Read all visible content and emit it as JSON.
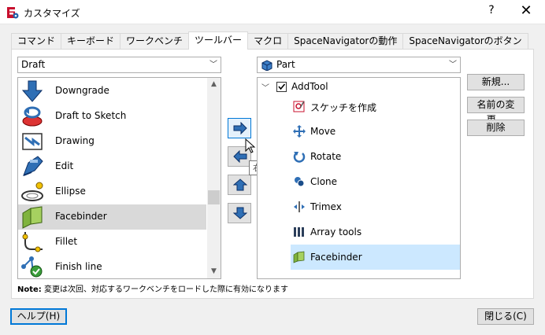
{
  "window": {
    "title": "カスタマイズ",
    "help_glyph": "?",
    "close_glyph": "✕"
  },
  "tabs": [
    "コマンド",
    "キーボード",
    "ワークベンチ",
    "ツールバー",
    "マクロ",
    "SpaceNavigatorの動作",
    "SpaceNavigatorのボタン"
  ],
  "active_tab": "ツールバー",
  "left": {
    "category": "Draft",
    "commands": [
      {
        "label": "Downgrade",
        "icon": "downgrade-icon"
      },
      {
        "label": "Draft to Sketch",
        "icon": "draft-to-sketch-icon"
      },
      {
        "label": "Drawing",
        "icon": "drawing-icon"
      },
      {
        "label": "Edit",
        "icon": "edit-icon"
      },
      {
        "label": "Ellipse",
        "icon": "ellipse-icon"
      },
      {
        "label": "Facebinder",
        "icon": "facebinder-icon",
        "selected": true
      },
      {
        "label": "Fillet",
        "icon": "fillet-icon"
      },
      {
        "label": "Finish line",
        "icon": "finish-line-icon"
      }
    ]
  },
  "middle": {
    "move_right_tooltip": "右へ移動"
  },
  "right": {
    "workbench": "Part",
    "toolbar_name": "AddTool",
    "toolbar_checked": true,
    "items": [
      {
        "label": "スケッチを作成",
        "icon": "create-sketch-icon"
      },
      {
        "label": "Move",
        "icon": "move-icon"
      },
      {
        "label": "Rotate",
        "icon": "rotate-icon"
      },
      {
        "label": "Clone",
        "icon": "clone-icon"
      },
      {
        "label": "Trimex",
        "icon": "trimex-icon"
      },
      {
        "label": "Array tools",
        "icon": "array-tools-icon"
      },
      {
        "label": "Facebinder",
        "icon": "facebinder-icon",
        "selected": true
      }
    ]
  },
  "side_buttons": {
    "new": "新規...",
    "rename": "名前の変更...",
    "delete": "削除"
  },
  "note": {
    "prefix": "Note:",
    "text": " 変更は次回、対応するワークベンチをロードした際に有効になります"
  },
  "footer": {
    "help": "ヘルプ(H)",
    "close": "閉じる(C)"
  },
  "colors": {
    "accent": "#0078d7",
    "selection": "#cce8ff",
    "freecad_red": "#c8102e"
  }
}
